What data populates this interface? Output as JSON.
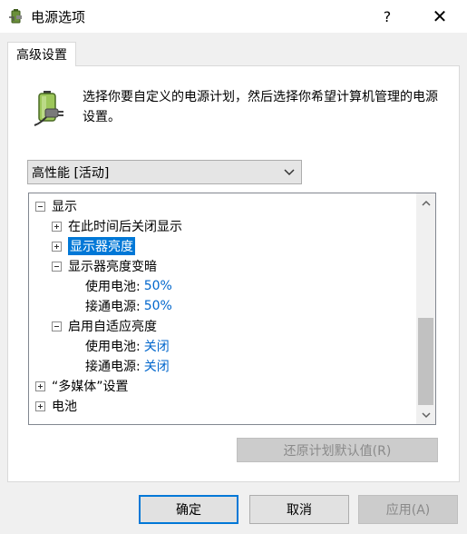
{
  "window": {
    "title": "电源选项",
    "help_label": "?",
    "close_label": "✕"
  },
  "tab": {
    "label": "高级设置"
  },
  "intro_text": "选择你要自定义的电源计划，然后选择你希望计算机管理的电源设置。",
  "plan_select": {
    "value": "高性能 [活动]"
  },
  "tree": {
    "display": "显示",
    "turn_off_display": "在此时间后关闭显示",
    "display_brightness": "显示器亮度",
    "dimmed_brightness": "显示器亮度变暗",
    "dimmed_on_battery_label": "使用电池:",
    "dimmed_on_battery_value": "50%",
    "dimmed_plugged_in_label": "接通电源:",
    "dimmed_plugged_in_value": "50%",
    "adaptive_brightness": "启用自适应亮度",
    "adaptive_on_battery_label": "使用电池:",
    "adaptive_on_battery_value": "关闭",
    "adaptive_plugged_in_label": "接通电源:",
    "adaptive_plugged_in_value": "关闭",
    "multimedia": "“多媒体”设置",
    "battery": "电池"
  },
  "buttons": {
    "restore": "还原计划默认值(R)",
    "ok": "确定",
    "cancel": "取消",
    "apply": "应用(A)"
  },
  "icons": {
    "app": "power-options-icon",
    "battery": "battery-plug-icon",
    "chevron": "chevron-down-icon",
    "scroll_up": "scroll-up-arrow-icon",
    "scroll_down": "scroll-down-arrow-icon"
  },
  "colors": {
    "selection": "#0078d7",
    "link_value": "#0066cc",
    "default_button_border": "#0078d7"
  }
}
